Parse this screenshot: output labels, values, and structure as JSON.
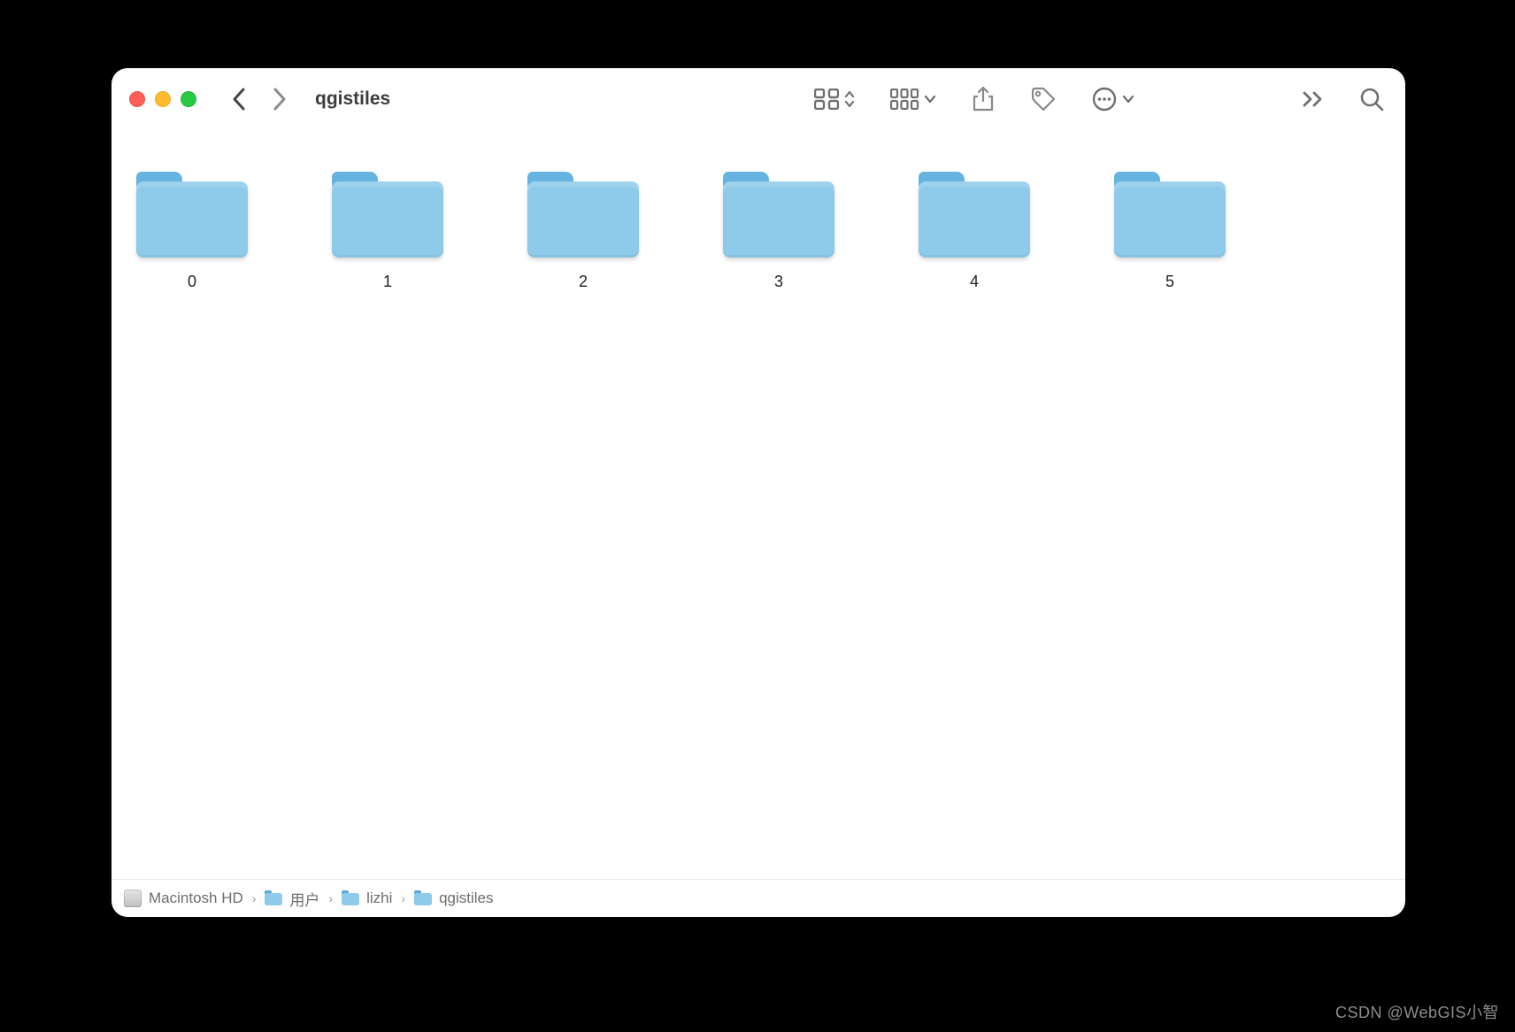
{
  "window": {
    "title": "qgistiles"
  },
  "folders": [
    {
      "name": "0"
    },
    {
      "name": "1"
    },
    {
      "name": "2"
    },
    {
      "name": "3"
    },
    {
      "name": "4"
    },
    {
      "name": "5"
    }
  ],
  "path": {
    "segments": [
      {
        "icon": "disk",
        "label": "Macintosh HD"
      },
      {
        "icon": "folder",
        "label": "用户"
      },
      {
        "icon": "home",
        "label": "lizhi"
      },
      {
        "icon": "folder",
        "label": "qgistiles"
      }
    ]
  },
  "watermark": "CSDN @WebGIS小智"
}
